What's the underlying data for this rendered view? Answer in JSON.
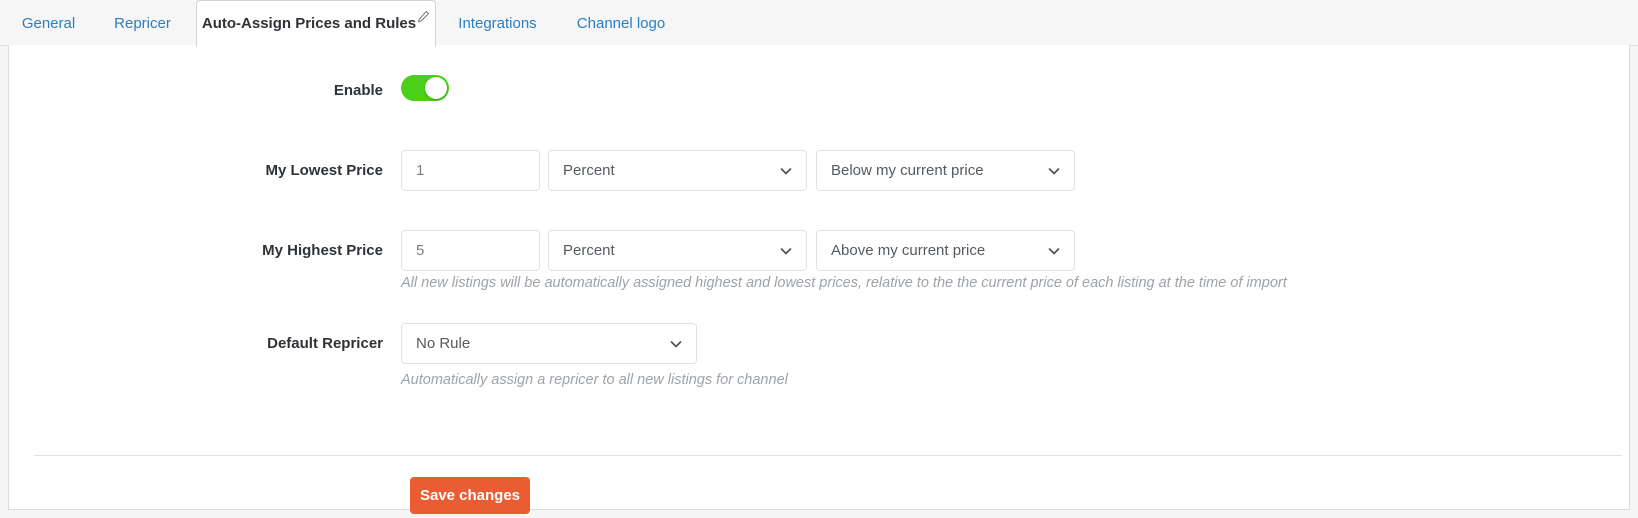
{
  "tabs": [
    {
      "label": "General",
      "active": false
    },
    {
      "label": "Repricer",
      "active": false
    },
    {
      "label": "Auto-Assign Prices and Rules",
      "active": true,
      "icon": "pencil-icon"
    },
    {
      "label": "Integrations",
      "active": false
    },
    {
      "label": "Channel logo",
      "active": false
    }
  ],
  "form": {
    "enable": {
      "label": "Enable",
      "state": "on",
      "accent_color": "#4bcf18"
    },
    "lowest_price": {
      "label": "My Lowest Price",
      "amount": "1",
      "unit": "Percent",
      "direction": "Below my current price"
    },
    "highest_price": {
      "label": "My Highest Price",
      "amount": "5",
      "unit": "Percent",
      "direction": "Above my current price"
    },
    "prices_helper": "All new listings will be automatically assigned highest and lowest prices, relative to the the current price of each listing at the time of import",
    "default_repricer": {
      "label": "Default Repricer",
      "value": "No Rule",
      "helper": "Automatically assign a repricer to all new listings for channel"
    },
    "save_label": "Save changes",
    "save_color": "#ea5d33"
  }
}
